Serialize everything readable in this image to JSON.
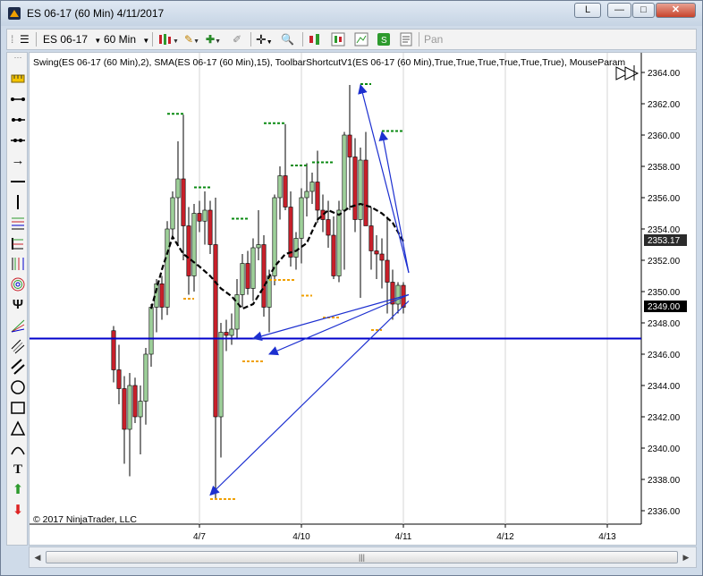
{
  "window": {
    "title": "ES 06-17 (60 Min)  4/11/2017",
    "buttons": {
      "help": "L",
      "minimize": "—",
      "restore": "□",
      "close": "✕"
    }
  },
  "toolbar": {
    "instrument": "ES 06-17",
    "interval": "60 Min",
    "pan_label": "Pan",
    "icons": [
      "chart-style-icon",
      "pencil-icon",
      "plus-icon",
      "eraser-icon",
      "crosshair-icon",
      "zoom-icon",
      "indicators-icon",
      "strategies-icon",
      "templates-icon",
      "save-icon",
      "properties-icon"
    ]
  },
  "drawing_tools": [
    "ruler-icon",
    "line-icon",
    "ray-icon",
    "extended-line-icon",
    "arrow-line-icon",
    "horizontal-line-icon",
    "vertical-line-icon",
    "fib-retracement-icon",
    "fib-extension-icon",
    "fib-time-icon",
    "fib-circle-icon",
    "andrews-pitchfork-icon",
    "gann-fan-icon",
    "regression-channel-icon",
    "trend-channel-icon",
    "ellipse-icon",
    "rectangle-icon",
    "triangle-icon",
    "arc-icon",
    "text-icon",
    "arrow-up-icon",
    "arrow-down-icon"
  ],
  "chart": {
    "indicator_label": "Swing(ES 06-17 (60 Min),2), SMA(ES 06-17 (60 Min),15), ToolbarShortcutV1(ES 06-17 (60 Min),True,True,True,True,True,True), MouseParam",
    "copyright": "© 2017 NinjaTrader, LLC",
    "last_price_label": "2353.17",
    "current_price_label": "2349.00",
    "colors": {
      "up": "#9ed09a",
      "down": "#c8202a",
      "sma": "#000000",
      "swing_high": "#0a8a12",
      "swing_low": "#f0a000",
      "line": "#0000cc",
      "arrow": "#1c2fd0",
      "last_price_bg": "#2b2b2b",
      "current_price_bg": "#000000"
    }
  },
  "chart_data": {
    "type": "candlestick",
    "instrument": "ES 06-17",
    "interval": "60 Min",
    "ylim": [
      2335.2,
      2365.4
    ],
    "y_ticks": [
      "2364.00",
      "2362.00",
      "2360.00",
      "2358.00",
      "2356.00",
      "2354.00",
      "2352.00",
      "2350.00",
      "2348.00",
      "2346.00",
      "2344.00",
      "2342.00",
      "2340.00",
      "2338.00",
      "2336.00"
    ],
    "x_ticks": [
      {
        "label": "4/7",
        "bar": 16
      },
      {
        "label": "4/10",
        "bar": 35
      },
      {
        "label": "4/11",
        "bar": 54
      },
      {
        "label": "4/12",
        "bar": 73
      },
      {
        "label": "4/13",
        "bar": 92
      }
    ],
    "bar_count_visible": 97,
    "candles": [
      [
        2347.5,
        2347.8,
        2344.2,
        2345.0
      ],
      [
        2345.0,
        2346.6,
        2342.8,
        2343.8
      ],
      [
        2343.8,
        2344.6,
        2339.0,
        2341.2
      ],
      [
        2341.2,
        2344.8,
        2338.2,
        2344.0
      ],
      [
        2344.0,
        2344.5,
        2341.6,
        2342.0
      ],
      [
        2342.0,
        2344.0,
        2339.6,
        2343.0
      ],
      [
        2343.0,
        2346.4,
        2341.5,
        2346.0
      ],
      [
        2346.0,
        2349.2,
        2345.2,
        2349.0
      ],
      [
        2349.0,
        2350.8,
        2347.4,
        2350.5
      ],
      [
        2350.5,
        2351.0,
        2348.2,
        2349.0
      ],
      [
        2349.0,
        2354.5,
        2348.5,
        2354.0
      ],
      [
        2354.0,
        2356.4,
        2353.6,
        2356.0
      ],
      [
        2356.0,
        2359.6,
        2353.0,
        2357.2
      ],
      [
        2357.2,
        2361.3,
        2352.0,
        2354.2
      ],
      [
        2354.2,
        2355.4,
        2349.8,
        2351.0
      ],
      [
        2351.0,
        2355.6,
        2350.0,
        2355.0
      ],
      [
        2355.0,
        2355.8,
        2353.8,
        2354.5
      ],
      [
        2354.5,
        2356.4,
        2353.0,
        2355.2
      ],
      [
        2355.2,
        2355.8,
        2352.4,
        2353.0
      ],
      [
        2353.0,
        2356.0,
        2336.8,
        2342.0
      ],
      [
        2342.0,
        2348.0,
        2339.4,
        2347.4
      ],
      [
        2347.4,
        2348.2,
        2346.2,
        2347.2
      ],
      [
        2347.2,
        2348.6,
        2346.6,
        2347.6
      ],
      [
        2347.6,
        2350.8,
        2347.0,
        2349.8
      ],
      [
        2349.8,
        2352.4,
        2349.0,
        2351.8
      ],
      [
        2351.8,
        2352.6,
        2349.8,
        2350.2
      ],
      [
        2350.2,
        2353.4,
        2349.4,
        2352.8
      ],
      [
        2352.8,
        2355.2,
        2352.0,
        2353.0
      ],
      [
        2353.0,
        2353.6,
        2348.4,
        2349.0
      ],
      [
        2349.0,
        2351.4,
        2347.4,
        2351.0
      ],
      [
        2351.0,
        2356.2,
        2350.4,
        2356.0
      ],
      [
        2356.0,
        2358.0,
        2354.6,
        2357.4
      ],
      [
        2357.4,
        2360.7,
        2355.2,
        2355.4
      ],
      [
        2355.4,
        2356.4,
        2351.6,
        2352.2
      ],
      [
        2352.2,
        2353.8,
        2351.4,
        2353.4
      ],
      [
        2353.4,
        2356.6,
        2351.8,
        2356.0
      ],
      [
        2356.0,
        2358.2,
        2354.8,
        2356.4
      ],
      [
        2356.4,
        2357.6,
        2355.6,
        2357.0
      ],
      [
        2357.0,
        2359.0,
        2354.4,
        2355.2
      ],
      [
        2355.2,
        2356.2,
        2353.8,
        2354.6
      ],
      [
        2354.6,
        2355.8,
        2352.8,
        2353.6
      ],
      [
        2353.6,
        2354.8,
        2350.8,
        2351.0
      ],
      [
        2351.0,
        2355.8,
        2350.6,
        2355.2
      ],
      [
        2355.2,
        2360.2,
        2351.4,
        2360.0
      ],
      [
        2360.0,
        2363.2,
        2355.2,
        2358.6
      ],
      [
        2358.6,
        2359.8,
        2353.8,
        2354.6
      ],
      [
        2354.6,
        2359.2,
        2349.6,
        2358.4
      ],
      [
        2358.4,
        2360.2,
        2355.6,
        2354.2
      ],
      [
        2354.2,
        2355.4,
        2351.4,
        2352.6
      ],
      [
        2352.6,
        2353.6,
        2350.8,
        2352.4
      ],
      [
        2352.4,
        2353.4,
        2350.2,
        2352.0
      ],
      [
        2352.0,
        2354.8,
        2348.6,
        2350.6
      ],
      [
        2350.6,
        2351.4,
        2348.2,
        2349.2
      ],
      [
        2349.2,
        2350.6,
        2348.6,
        2350.4
      ],
      [
        2350.4,
        2350.6,
        2348.6,
        2349.0
      ]
    ],
    "sma_15": [
      [
        7,
        2348.9
      ],
      [
        9,
        2351.4
      ],
      [
        11,
        2353.5
      ],
      [
        13,
        2352.4
      ],
      [
        16,
        2351.6
      ],
      [
        18,
        2351.0
      ],
      [
        20,
        2350.2
      ],
      [
        22,
        2349.7
      ],
      [
        24,
        2348.9
      ],
      [
        26,
        2349.2
      ],
      [
        28,
        2350.3
      ],
      [
        30,
        2351.6
      ],
      [
        32,
        2352.4
      ],
      [
        34,
        2352.6
      ],
      [
        36,
        2353.1
      ],
      [
        38,
        2354.6
      ],
      [
        40,
        2355.2
      ],
      [
        42,
        2354.9
      ],
      [
        44,
        2355.4
      ],
      [
        46,
        2355.6
      ],
      [
        48,
        2355.4
      ],
      [
        50,
        2355.0
      ],
      [
        52,
        2354.4
      ],
      [
        54,
        2353.2
      ]
    ],
    "swing_highs": [
      [
        10,
        13,
        2361.3
      ],
      [
        15,
        18,
        2356.6
      ],
      [
        22,
        25,
        2354.6
      ],
      [
        28,
        32,
        2360.7
      ],
      [
        33,
        36,
        2358.0
      ],
      [
        37,
        41,
        2358.2
      ],
      [
        46,
        48,
        2363.2
      ],
      [
        50,
        54,
        2360.2
      ]
    ],
    "swing_lows": [
      [
        13,
        15,
        2349.6
      ],
      [
        18,
        23,
        2336.8
      ],
      [
        24,
        28,
        2345.6
      ],
      [
        29,
        34,
        2350.8
      ],
      [
        35,
        37,
        2349.8
      ],
      [
        39,
        42,
        2348.4
      ],
      [
        48,
        50,
        2347.6
      ]
    ],
    "horizontal_line": 2347.0,
    "arrows": [
      {
        "from": [
          55,
          2351.2
        ],
        "to": [
          46,
          2363.2
        ]
      },
      {
        "from": [
          55,
          2351.2
        ],
        "to": [
          50,
          2360.2
        ]
      },
      {
        "from": [
          55,
          2349.8
        ],
        "to": [
          26,
          2347.0
        ]
      },
      {
        "from": [
          55,
          2349.8
        ],
        "to": [
          29,
          2346.0
        ]
      },
      {
        "from": [
          55,
          2349.4
        ],
        "to": [
          18,
          2337.0
        ]
      }
    ]
  }
}
